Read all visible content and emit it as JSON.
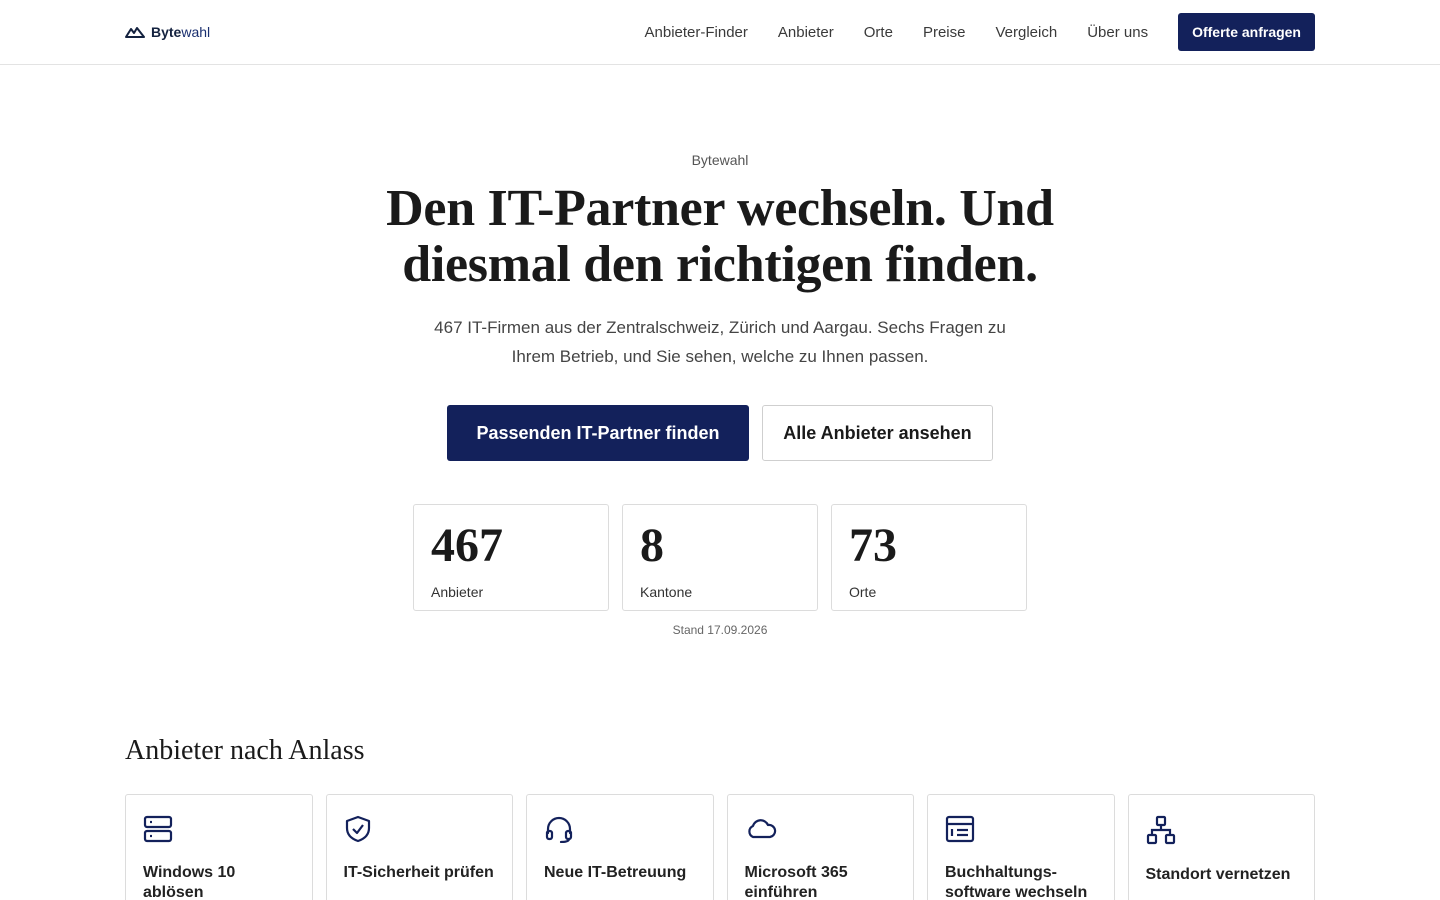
{
  "header": {
    "logo_main": "Byte",
    "logo_accent": "wahl",
    "nav": [
      "Anbieter-Finder",
      "Anbieter",
      "Orte",
      "Preise",
      "Vergleich",
      "Über uns"
    ],
    "cta": "Offerte anfragen"
  },
  "hero": {
    "eyebrow": "Bytewahl",
    "title": "Den IT-Partner wechseln. Und diesmal den richtigen finden.",
    "lead": "467 IT-Firmen aus der Zentralschweiz, Zürich und Aargau. Sechs Fragen zu Ihrem Betrieb, und Sie sehen, welche zu Ihnen passen.",
    "primary_button": "Passenden IT-Partner finden",
    "secondary_button": "Alle Anbieter ansehen"
  },
  "stats": [
    {
      "value": "467",
      "label": "Anbieter"
    },
    {
      "value": "8",
      "label": "Kantone"
    },
    {
      "value": "73",
      "label": "Orte"
    }
  ],
  "stand": "Stand 17.09.2026",
  "section": {
    "title": "Anbieter nach Anlass",
    "cards": [
      {
        "title": "Windows 10 ablösen",
        "icon": "server-icon"
      },
      {
        "title": "IT-Sicherheit prüfen",
        "icon": "shield-check-icon"
      },
      {
        "title": "Neue IT-Betreuung",
        "icon": "headset-icon"
      },
      {
        "title": "Microsoft 365 einführen",
        "icon": "cloud-icon"
      },
      {
        "title": "Buchhaltungs-software wechseln",
        "icon": "document-layout-icon"
      },
      {
        "title": "Standort vernetzen",
        "icon": "network-icon"
      }
    ]
  },
  "colors": {
    "primary": "#13215b",
    "border": "#dcdcdc"
  }
}
